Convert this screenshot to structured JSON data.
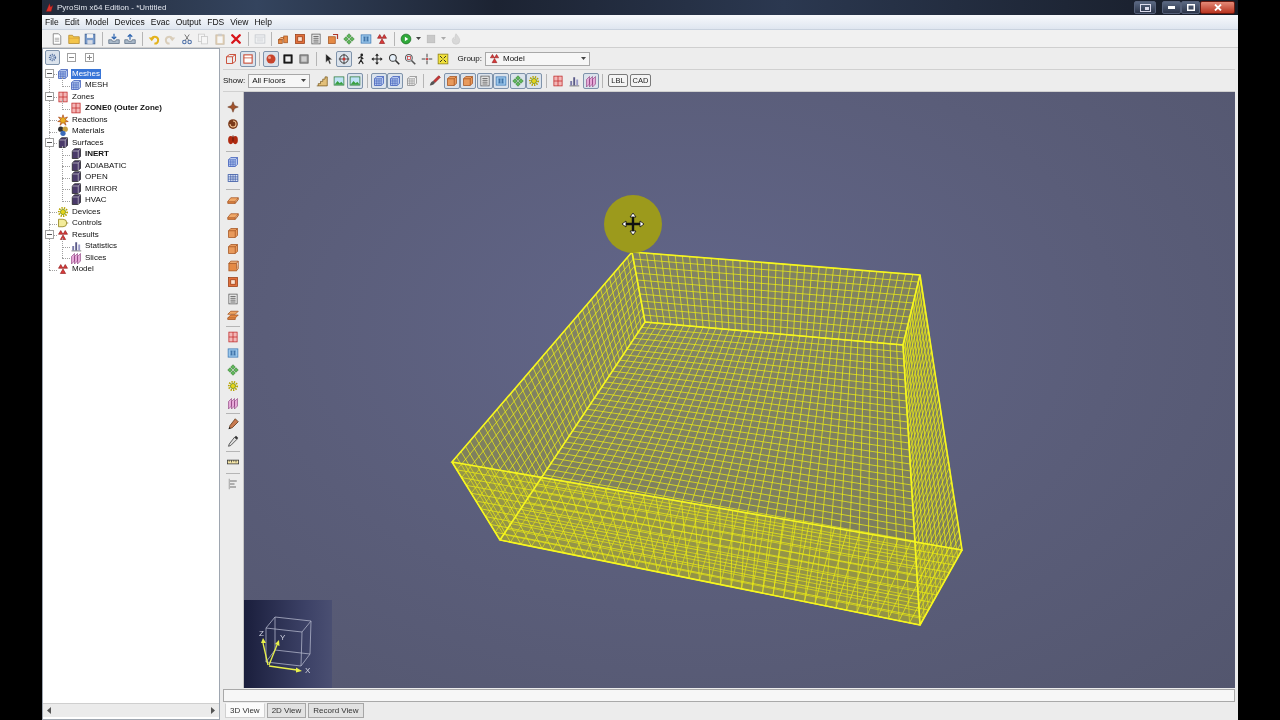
{
  "window": {
    "title": "PyroSim x64 Edition - *Untitled"
  },
  "menu": [
    "File",
    "Edit",
    "Model",
    "Devices",
    "Evac",
    "Output",
    "FDS",
    "View",
    "Help"
  ],
  "main_toolbar": [
    {
      "kind": "document",
      "disabled": false
    },
    {
      "kind": "folder",
      "disabled": false
    },
    {
      "kind": "floppy-disk",
      "disabled": false
    },
    {
      "kind": "separator"
    },
    {
      "kind": "tray-in",
      "disabled": false
    },
    {
      "kind": "tray-out",
      "disabled": false
    },
    {
      "kind": "separator"
    },
    {
      "kind": "undo",
      "disabled": false
    },
    {
      "kind": "redo",
      "disabled": true
    },
    {
      "kind": "scissors",
      "disabled": false
    },
    {
      "kind": "copy",
      "disabled": true
    },
    {
      "kind": "clipboard",
      "disabled": true
    },
    {
      "kind": "delete",
      "disabled": false
    },
    {
      "kind": "separator"
    },
    {
      "kind": "window",
      "disabled": true
    },
    {
      "kind": "separator"
    },
    {
      "kind": "blocks",
      "disabled": false
    },
    {
      "kind": "frame",
      "disabled": false
    },
    {
      "kind": "sheet",
      "disabled": false
    },
    {
      "kind": "block-arrow",
      "disabled": false
    },
    {
      "kind": "diamonds",
      "disabled": false
    },
    {
      "kind": "tile",
      "disabled": false
    },
    {
      "kind": "pyramids",
      "disabled": false
    },
    {
      "kind": "separator"
    },
    {
      "kind": "play",
      "disabled": false
    },
    {
      "kind": "caret",
      "disabled": false
    },
    {
      "kind": "stop",
      "disabled": true
    },
    {
      "kind": "caret",
      "disabled": true
    },
    {
      "kind": "flame",
      "disabled": true
    }
  ],
  "tree_toolbar": [
    {
      "kind": "gear",
      "pressed": true
    },
    {
      "kind": "collapse",
      "pressed": false
    },
    {
      "kind": "expand",
      "pressed": false
    }
  ],
  "tree": [
    {
      "label": "Meshes",
      "kind": "mesh-cube",
      "selected": true,
      "bold": false,
      "expanded": true,
      "children": [
        {
          "label": "MESH",
          "kind": "mesh-cube",
          "selected": false,
          "bold": false
        }
      ]
    },
    {
      "label": "Zones",
      "kind": "zone-grid",
      "selected": false,
      "bold": false,
      "expanded": true,
      "children": [
        {
          "label": "ZONE0 (Outer Zone)",
          "kind": "zone-grid",
          "selected": false,
          "bold": true
        }
      ]
    },
    {
      "label": "Reactions",
      "kind": "burst",
      "selected": false,
      "bold": false
    },
    {
      "label": "Materials",
      "kind": "spheres",
      "selected": false,
      "bold": false
    },
    {
      "label": "Surfaces",
      "kind": "surface",
      "selected": false,
      "bold": false,
      "expanded": true,
      "children": [
        {
          "label": "INERT",
          "kind": "surface",
          "selected": false,
          "bold": true
        },
        {
          "label": "ADIABATIC",
          "kind": "surface",
          "selected": false,
          "bold": false
        },
        {
          "label": "OPEN",
          "kind": "surface",
          "selected": false,
          "bold": false
        },
        {
          "label": "MIRROR",
          "kind": "surface",
          "selected": false,
          "bold": false
        },
        {
          "label": "HVAC",
          "kind": "surface",
          "selected": false,
          "bold": false
        }
      ]
    },
    {
      "label": "Devices",
      "kind": "sun",
      "selected": false,
      "bold": false
    },
    {
      "label": "Controls",
      "kind": "gate",
      "selected": false,
      "bold": false
    },
    {
      "label": "Results",
      "kind": "pyramids",
      "selected": false,
      "bold": false,
      "expanded": true,
      "children": [
        {
          "label": "Statistics",
          "kind": "chart",
          "selected": false,
          "bold": false
        },
        {
          "label": "Slices",
          "kind": "slices",
          "selected": false,
          "bold": false
        }
      ]
    },
    {
      "label": "Model",
      "kind": "pyramids",
      "selected": false,
      "bold": false
    }
  ],
  "view_toolbar": {
    "tools": [
      {
        "kind": "wire-cube",
        "pressed": false
      },
      {
        "kind": "outline-cube",
        "pressed": true
      },
      {
        "kind": "separator"
      },
      {
        "kind": "sphere",
        "pressed": true
      },
      {
        "kind": "filled-square",
        "pressed": false
      },
      {
        "kind": "shaded-square",
        "pressed": false
      },
      {
        "kind": "separator"
      },
      {
        "kind": "pointer",
        "pressed": false
      },
      {
        "kind": "orbit",
        "pressed": true
      },
      {
        "kind": "walker",
        "pressed": false
      },
      {
        "kind": "move",
        "pressed": false
      },
      {
        "kind": "zoom",
        "pressed": false
      },
      {
        "kind": "zoom-box",
        "pressed": false
      },
      {
        "kind": "crosshair",
        "pressed": false
      },
      {
        "kind": "fit",
        "pressed": false
      }
    ],
    "group_label": "Group:",
    "group_value": "Model"
  },
  "display_toolbar": {
    "show_label": "Show:",
    "floor_value": "All Floors",
    "tools": [
      {
        "kind": "stairs",
        "pressed": false
      },
      {
        "kind": "picture",
        "pressed": false
      },
      {
        "kind": "picture",
        "pressed": true
      },
      {
        "kind": "separator"
      },
      {
        "kind": "mesh-cube",
        "pressed": true
      },
      {
        "kind": "mesh-cube",
        "pressed": true
      },
      {
        "kind": "outline-mesh",
        "pressed": false
      },
      {
        "kind": "separator"
      },
      {
        "kind": "brush",
        "pressed": false
      },
      {
        "kind": "block",
        "pressed": true
      },
      {
        "kind": "block",
        "pressed": true
      },
      {
        "kind": "sheet",
        "pressed": true
      },
      {
        "kind": "tile",
        "pressed": true
      },
      {
        "kind": "diamonds",
        "pressed": true
      },
      {
        "kind": "sun",
        "pressed": true
      },
      {
        "kind": "separator"
      },
      {
        "kind": "zone-grid",
        "pressed": false
      },
      {
        "kind": "chart",
        "pressed": false
      },
      {
        "kind": "slices",
        "pressed": true
      },
      {
        "kind": "separator"
      }
    ],
    "buttons": [
      {
        "label": "LBL",
        "pressed": false
      },
      {
        "label": "CAD",
        "pressed": false
      }
    ]
  },
  "side_toolbar": [
    {
      "kind": "compass"
    },
    {
      "kind": "swirl"
    },
    {
      "kind": "blobs"
    },
    {
      "kind": "separator"
    },
    {
      "kind": "mesh-cube"
    },
    {
      "kind": "grid"
    },
    {
      "kind": "separator"
    },
    {
      "kind": "slab"
    },
    {
      "kind": "slab"
    },
    {
      "kind": "block"
    },
    {
      "kind": "block"
    },
    {
      "kind": "crate"
    },
    {
      "kind": "frame"
    },
    {
      "kind": "sheet"
    },
    {
      "kind": "slabs"
    },
    {
      "kind": "separator"
    },
    {
      "kind": "zone-grid"
    },
    {
      "kind": "tile"
    },
    {
      "kind": "diamonds"
    },
    {
      "kind": "sun"
    },
    {
      "kind": "slices"
    },
    {
      "kind": "separator"
    },
    {
      "kind": "pencil"
    },
    {
      "kind": "dropper"
    },
    {
      "kind": "separator"
    },
    {
      "kind": "ruler"
    },
    {
      "kind": "separator"
    },
    {
      "kind": "align"
    }
  ],
  "viewport": {
    "axis_labels": [
      "Z",
      "Y",
      "X"
    ]
  },
  "view_tabs": [
    {
      "label": "3D View",
      "selected": true
    },
    {
      "label": "2D View",
      "selected": false
    },
    {
      "label": "Record View",
      "selected": false
    }
  ]
}
